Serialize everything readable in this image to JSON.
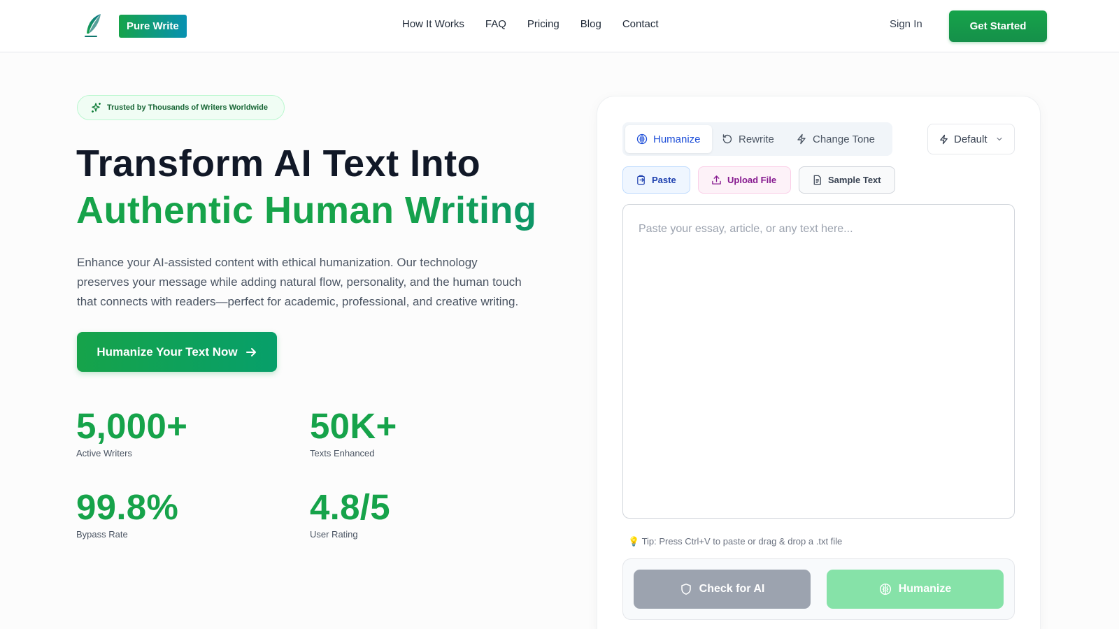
{
  "nav": {
    "brand": "Pure Write",
    "links": [
      "How It Works",
      "FAQ",
      "Pricing",
      "Blog",
      "Contact"
    ],
    "sign_in": "Sign In",
    "get_started": "Get Started"
  },
  "hero": {
    "badge": "Trusted by Thousands of Writers Worldwide",
    "title_line1": "Transform AI Text Into",
    "title_line2": "Authentic Human Writing",
    "description": "Enhance your AI-assisted content with ethical humanization. Our technology preserves your message while adding natural flow, personality, and the human touch that connects with readers—perfect for academic, professional, and creative writing.",
    "cta": "Humanize Your Text Now",
    "stats": [
      {
        "value": "5,000+",
        "label": "Active Writers"
      },
      {
        "value": "50K+",
        "label": "Texts Enhanced"
      },
      {
        "value": "99.8%",
        "label": "Bypass Rate"
      },
      {
        "value": "4.8/5",
        "label": "User Rating"
      }
    ]
  },
  "tool": {
    "modes": [
      "Humanize",
      "Rewrite",
      "Change Tone"
    ],
    "active_mode": "Humanize",
    "tone_select": "Default",
    "buttons": {
      "paste": "Paste",
      "upload": "Upload File",
      "sample": "Sample Text"
    },
    "placeholder": "Paste your essay, article, or any text here...",
    "tip": "💡 Tip: Press Ctrl+V to paste or drag & drop a .txt file",
    "check_ai": "Check for AI",
    "humanize": "Humanize"
  },
  "colors": {
    "accent_green": "#16a34a",
    "brand_gradient_end": "#0891b2",
    "active_tab_blue": "#1d4ed8"
  }
}
